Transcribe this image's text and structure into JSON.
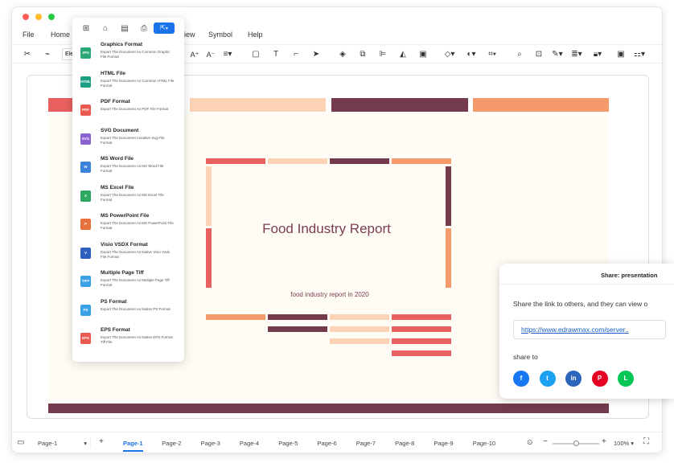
{
  "window": {
    "traffic_colors": [
      "#ff5f57",
      "#febc2e",
      "#28c840"
    ]
  },
  "menu": {
    "file": "File",
    "home": "Home",
    "view_fragment": "iew",
    "symbol": "Symbol",
    "help": "Help"
  },
  "toolbar": {
    "font_box_fragment": "Ele"
  },
  "export_menu": {
    "items": [
      {
        "badge": "JPG",
        "color": "#2aa876",
        "title": "Graphics Format",
        "desc": "Export The Document As Common Graphic File Format"
      },
      {
        "badge": "HTML",
        "color": "#19a085",
        "title": "HTML File",
        "desc": "Export The Document As Common HTML File Format"
      },
      {
        "badge": "PDF",
        "color": "#e8594f",
        "title": "PDF Format",
        "desc": "Export The Document As PDF File Format"
      },
      {
        "badge": "SVG",
        "color": "#8a63d2",
        "title": "SVG Document",
        "desc": "Export The Document Asnative Svg File Format"
      },
      {
        "badge": "W",
        "color": "#3b82d8",
        "title": "MS Word File",
        "desc": "Export The Document As MS Word File Format"
      },
      {
        "badge": "X",
        "color": "#2fa862",
        "title": "MS Excel File",
        "desc": "Export The Document As MS Excel File Format"
      },
      {
        "badge": "P",
        "color": "#e8703a",
        "title": "MS PowerPoint File",
        "desc": "Export The Document As MS PowerPoint File Format"
      },
      {
        "badge": "V",
        "color": "#2f5fbf",
        "title": "Visio VSDX Format",
        "desc": "Export The Document As Native Visio Vsdx File Format"
      },
      {
        "badge": "TIFF",
        "color": "#3aa0e6",
        "title": "Multiple Page Tiff",
        "desc": "Export The Document As Multiple Page Tiff Format"
      },
      {
        "badge": "PS",
        "color": "#3aa0e6",
        "title": "PS Format",
        "desc": "Export The Document As Native PS Format"
      },
      {
        "badge": "EPS",
        "color": "#e8594f",
        "title": "EPS Format",
        "desc": "Export The Document As Native EPS Format Tiff File"
      }
    ]
  },
  "slide": {
    "title": "Food Industry Report",
    "subtitle": "food industry report in 2020"
  },
  "share": {
    "header": "Share: presentation",
    "message": "Share the link to others, and they can view o",
    "link": "https://www.edrawmax.com/server..",
    "share_to": "share to",
    "networks": [
      {
        "name": "facebook-icon",
        "glyph": "f",
        "color": "#1877f2"
      },
      {
        "name": "twitter-icon",
        "glyph": "t",
        "color": "#1da1f2"
      },
      {
        "name": "linkedin-icon",
        "glyph": "in",
        "color": "#2d64bc"
      },
      {
        "name": "pinterest-icon",
        "glyph": "P",
        "color": "#e60023"
      },
      {
        "name": "line-icon",
        "glyph": "L",
        "color": "#06c755"
      }
    ]
  },
  "status": {
    "page_select": "Page-1",
    "pages": [
      "Page-1",
      "Page-2",
      "Page-3",
      "Page-4",
      "Page-5",
      "Page-6",
      "Page-7",
      "Page-8",
      "Page-9",
      "Page-10"
    ],
    "active_page": "Page-1",
    "zoom": "100%",
    "zoom_level": 0.5
  },
  "colors": {
    "accent": "#1a73e8",
    "coral": "#e8605f",
    "peach": "#fcd3b4",
    "wine": "#733b4c",
    "orange": "#f59a6a"
  }
}
